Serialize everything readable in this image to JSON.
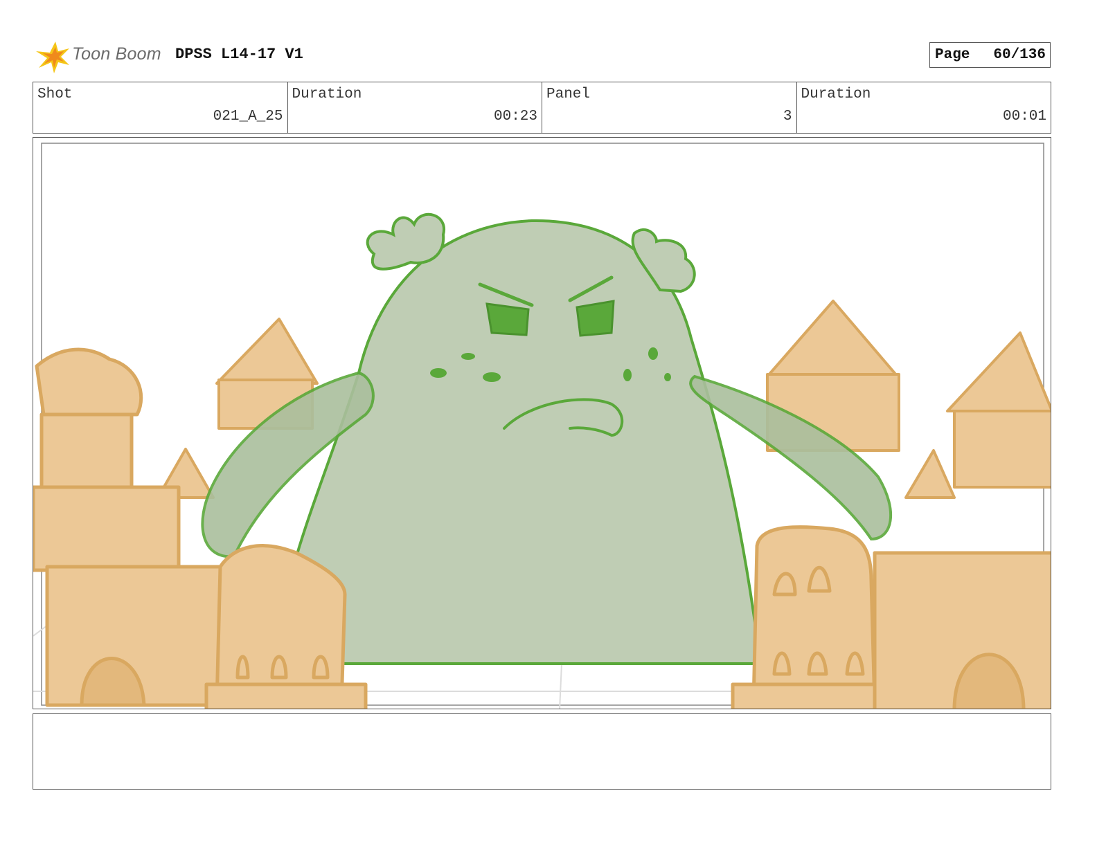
{
  "header": {
    "logo_text": "Toon Boom",
    "title": "DPSS L14-17 V1",
    "page_label": "Page",
    "page_value": "60/136"
  },
  "info": {
    "shot_label": "Shot",
    "shot_value": "021_A_25",
    "shot_duration_label": "Duration",
    "shot_duration_value": "00:23",
    "panel_label": "Panel",
    "panel_value": "3",
    "panel_duration_label": "Duration",
    "panel_duration_value": "00:01"
  },
  "panel_image": {
    "subject": "angry green blob creature among sandcastles",
    "colors": {
      "creature_fill": "#bfcdb4",
      "creature_line": "#5aa83a",
      "sand_fill": "#ecc896",
      "sand_line": "#d9a860"
    }
  },
  "notes": {
    "text": ""
  }
}
